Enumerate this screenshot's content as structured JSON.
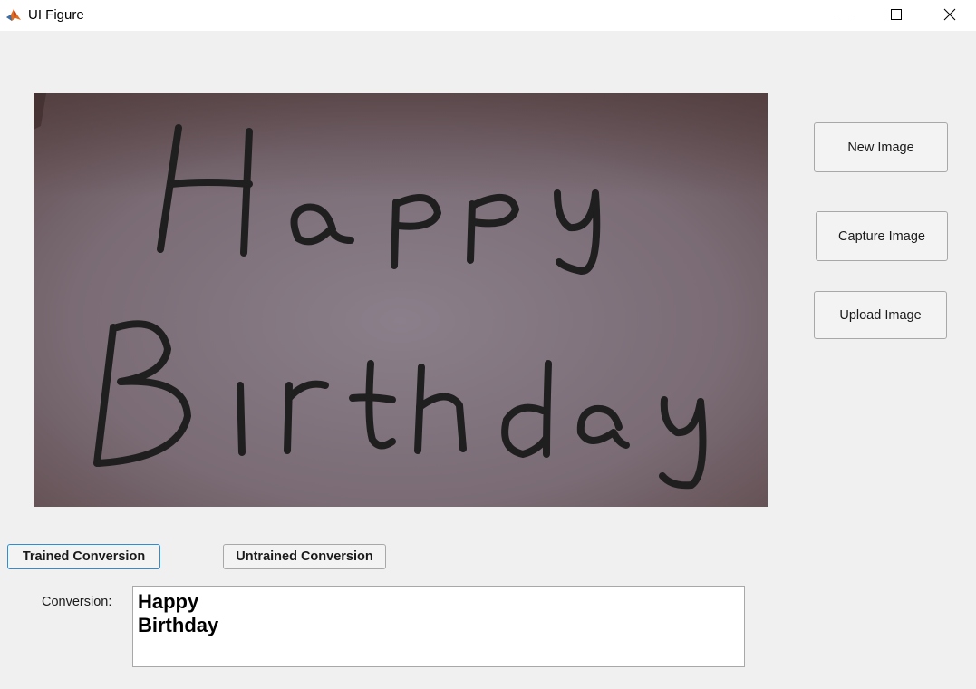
{
  "window": {
    "title": "UI Figure",
    "icon": "matlab-icon"
  },
  "image": {
    "handwritten_line_1": "Happy",
    "handwritten_line_2": "Birthday"
  },
  "buttons": {
    "new_image": "New Image",
    "capture_image": "Capture Image",
    "upload_image": "Upload Image",
    "trained_conversion": "Trained Conversion",
    "untrained_conversion": "Untrained Conversion"
  },
  "conversion": {
    "label": "Conversion:",
    "lines": [
      "Happy",
      "Birthday"
    ]
  },
  "colors": {
    "window_bg": "#f0f0f0",
    "focus_border": "#2b8fd6"
  }
}
